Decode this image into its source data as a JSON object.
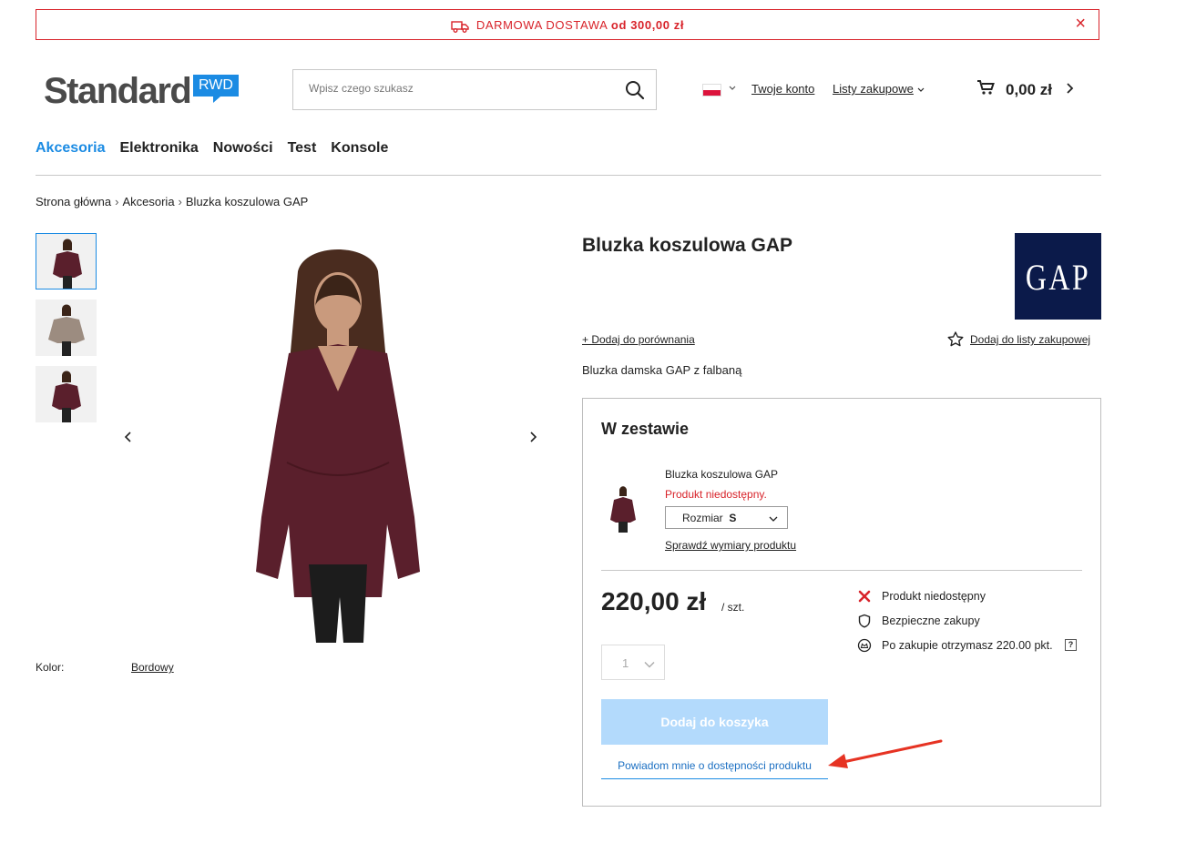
{
  "promo": {
    "text_caps": "DARMOWA DOSTAWA",
    "text_bold": "od 300,00 zł",
    "close": "×",
    "accent_color": "#d8232a"
  },
  "header": {
    "logo_word": "Standard",
    "logo_badge": "RWD",
    "search_placeholder": "Wpisz czego szukasz",
    "account_link": "Twoje konto",
    "lists_link": "Listy zakupowe",
    "cart_amount": "0,00 zł",
    "brand_color": "#1b8be3"
  },
  "nav": {
    "items": [
      "Akcesoria",
      "Elektronika",
      "Nowości",
      "Test",
      "Konsole"
    ],
    "active": "Akcesoria"
  },
  "breadcrumb": [
    "Strona główna",
    "Akcesoria",
    "Bluzka koszulowa GAP"
  ],
  "gallery": {
    "thumbnail_colors": [
      "#5a1f2c",
      "#9c8c80",
      "#5a1f2c"
    ],
    "attr_label": "Kolor:",
    "attr_value": "Bordowy"
  },
  "product": {
    "title": "Bluzka koszulowa GAP",
    "brand_logo_text": "GAP",
    "compare_link": "+ Dodaj do porównania",
    "add_to_list_link": "Dodaj do listy zakupowej",
    "description": "Bluzka damska GAP z falbaną"
  },
  "set": {
    "title": "W zestawie",
    "item_name": "Bluzka koszulowa GAP",
    "item_status": "Produkt niedostępny.",
    "size_label": "Rozmiar",
    "size_value": "S",
    "dimensions_link": "Sprawdź wymiary produktu"
  },
  "purchase": {
    "price": "220,00 zł",
    "unit": "/ szt.",
    "status_unavailable": "Produkt niedostępny",
    "secure": "Bezpieczne zakupy",
    "points": "Po zakupie otrzymasz 220.00 pkt.",
    "help": "?",
    "quantity": "1",
    "add_to_cart": "Dodaj do koszyka",
    "notify": "Powiadom mnie o dostępności produktu"
  }
}
